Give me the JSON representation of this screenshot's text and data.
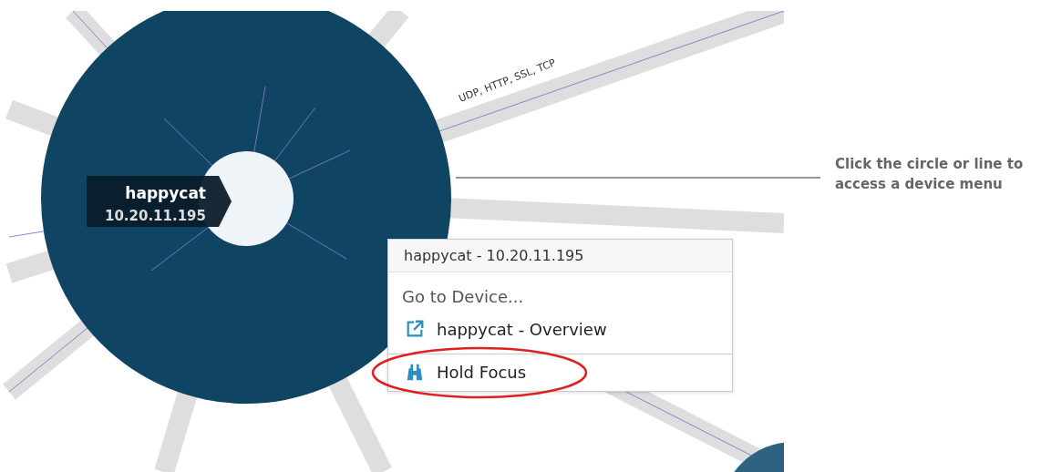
{
  "map": {
    "node": {
      "name": "happycat",
      "address": "10.20.11.195"
    },
    "link_label": "UDP, HTTP, SSL, TCP"
  },
  "context_menu": {
    "header": "happycat - 10.20.11.195",
    "section_label": "Go to Device...",
    "items": [
      {
        "kind": "link",
        "label": "happycat - Overview",
        "highlighted": false
      },
      {
        "kind": "focus",
        "label": "Hold Focus",
        "highlighted": true
      }
    ]
  },
  "callout": "Click the circle or line to access a device menu"
}
